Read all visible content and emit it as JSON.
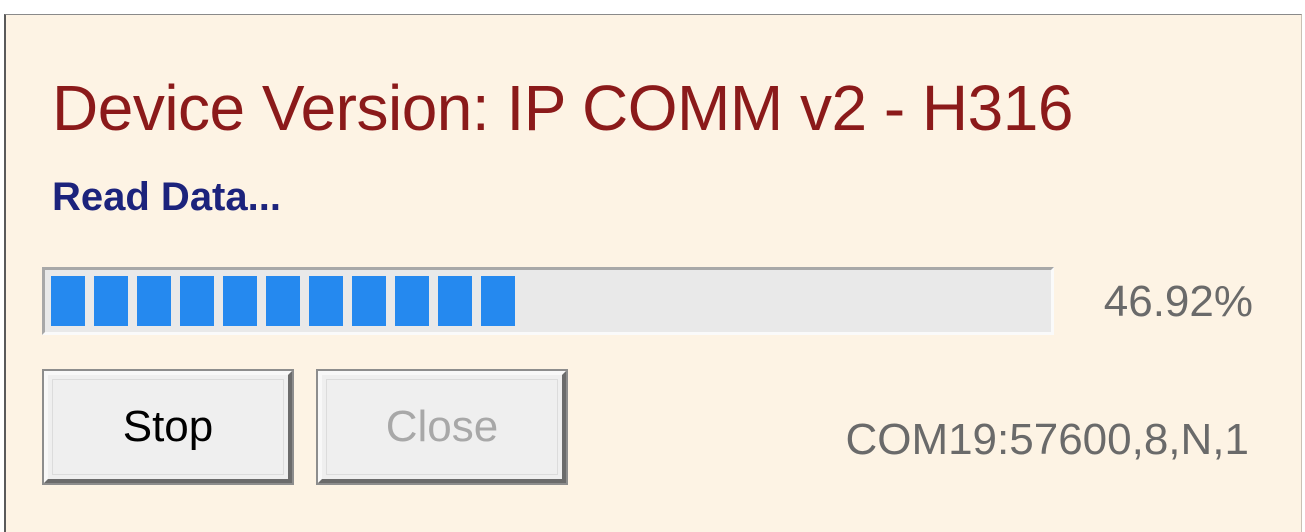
{
  "dialog": {
    "title": "Device Version: IP COMM v2 - H316",
    "status_text": "Read Data...",
    "progress": {
      "percent_text": "46.92%",
      "fraction": 0.4692
    },
    "buttons": {
      "stop_label": "Stop",
      "close_label": "Close",
      "close_enabled": false
    },
    "port_info": "COM19:57600,8,N,1"
  },
  "colors": {
    "background": "#fdf3e4",
    "title": "#8b1a1a",
    "status": "#1c237c",
    "progress_fill": "#2589ef",
    "progress_track": "#e9e9e9",
    "muted_text": "#6a6a6a"
  }
}
